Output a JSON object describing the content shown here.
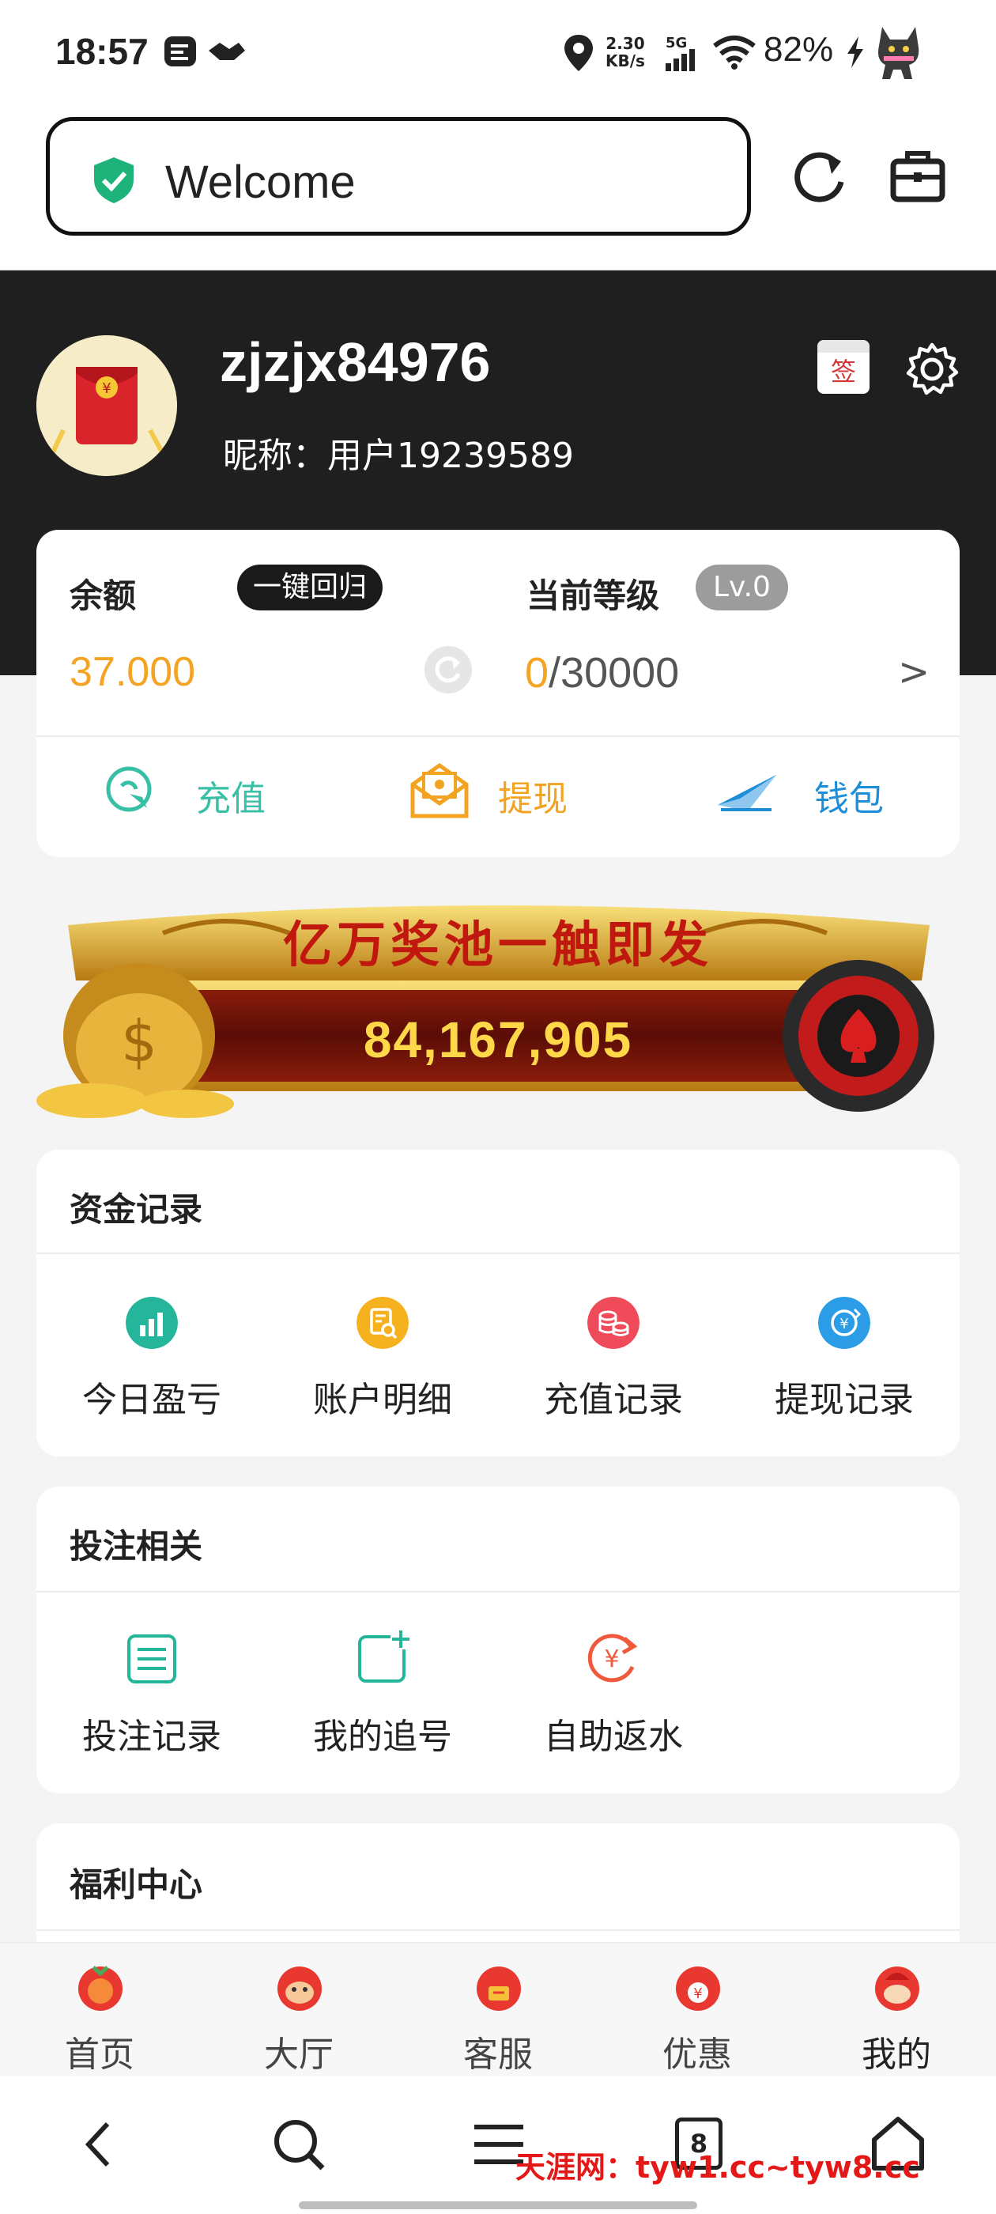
{
  "status_bar": {
    "time": "18:57",
    "speed_top": "2.30",
    "speed_unit": "KB/s",
    "network": "5G",
    "battery": "82%"
  },
  "url_bar": {
    "text": "Welcome"
  },
  "profile": {
    "username": "zjzjx84976",
    "nickname": "昵称：用户19239589",
    "sign_label": "签"
  },
  "account": {
    "balance_label": "余额",
    "recall_button": "一键回归",
    "balance_value": "37.000",
    "level_label": "当前等级",
    "level_badge": "Lv.0",
    "level_progress_current": "0",
    "level_progress_total": "/30000",
    "chevron": ">",
    "actions": [
      {
        "label": "充值",
        "color": "#37c0a6"
      },
      {
        "label": "提现",
        "color": "#f2a321"
      },
      {
        "label": "钱包",
        "color": "#1f8ed8"
      }
    ]
  },
  "banner": {
    "title": "亿万奖池一触即发",
    "jackpot": "84,167,905"
  },
  "fund_records": {
    "title": "资金记录",
    "items": [
      {
        "label": "今日盈亏",
        "icon": "chart-icon",
        "color": "#25b59a"
      },
      {
        "label": "账户明细",
        "icon": "document-search-icon",
        "color": "#f6b21e"
      },
      {
        "label": "充值记录",
        "icon": "coins-icon",
        "color": "#ef4b5a"
      },
      {
        "label": "提现记录",
        "icon": "yen-exchange-icon",
        "color": "#2a9de6"
      }
    ]
  },
  "betting": {
    "title": "投注相关",
    "items": [
      {
        "label": "投注记录",
        "icon": "list-icon",
        "color": "#25b59a"
      },
      {
        "label": "我的追号",
        "icon": "add-note-icon",
        "color": "#25b59a"
      },
      {
        "label": "自助返水",
        "icon": "yen-refund-icon",
        "color": "#ef5a3c"
      }
    ]
  },
  "welfare": {
    "title": "福利中心"
  },
  "tabs": [
    {
      "label": "首页"
    },
    {
      "label": "大厅"
    },
    {
      "label": "客服"
    },
    {
      "label": "优惠"
    },
    {
      "label": "我的"
    }
  ],
  "nav": {
    "tabs_count": "8"
  },
  "watermark": "天涯网：tyw1.cc~tyw8.cc"
}
